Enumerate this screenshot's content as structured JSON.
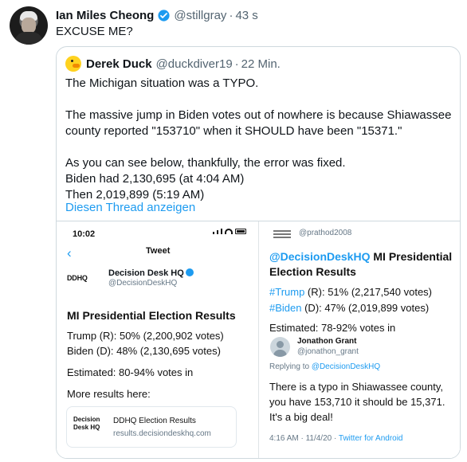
{
  "tweet": {
    "author_name": "Ian Miles Cheong",
    "author_handle": "@stillgray",
    "separator": "·",
    "time": "43 s",
    "text": "EXCUSE ME?"
  },
  "quote": {
    "author_name": "Derek Duck",
    "author_handle": "@duckdiver19",
    "separator": "·",
    "time": "22 Min.",
    "body": [
      "The Michigan situation was a TYPO.",
      "The massive jump in Biden votes out of nowhere is because Shiawassee county reported \"153710\" when it SHOULD have been \"15371.\"",
      "As you can see below, thankfully, the error was fixed.",
      "Biden had 2,130,695 (at 4:04 AM)",
      "Then 2,019,899 (5:19 AM)"
    ],
    "thread_link": "Diesen Thread anzeigen"
  },
  "media": {
    "left": {
      "status_time": "10:02",
      "back_icon": "chevron-left-icon",
      "heading": "Tweet",
      "account_name": "Decision Desk HQ",
      "account_handle": "@DecisionDeskHQ",
      "account_logo": "DDHQ",
      "title": "MI Presidential Election Results",
      "line1": "Trump (R): 50% (2,200,902 votes)",
      "line2": "Biden (D): 48% (2,130,695 votes)",
      "line3": "Estimated: 80-94% votes in",
      "line4": "More results here:",
      "card_logo": "Decision\nDesk HQ",
      "card_title": "DDHQ Election Results",
      "card_url": "results.decisiondeskhq.com"
    },
    "right": {
      "handle": "@prathod2008",
      "title_mention": "@DecisionDeskHQ",
      "title_rest": " MI Presidential Election Results",
      "trump_tag": "#Trump",
      "trump_rest": " (R): 51% (2,217,540 votes)",
      "biden_tag": "#Biden",
      "biden_rest": " (D): 47% (2,019,899 votes)",
      "estimate": "Estimated: 78-92% votes in",
      "reply_name": "Jonathon Grant",
      "reply_handle": "@jonathon_grant",
      "replying_prefix": "Replying to ",
      "replying_to": "@DecisionDeskHQ",
      "reply_text": [
        "There is a typo in Shiawassee county,",
        "you have 153,710 it should be 15,371.",
        "It's a big deal!"
      ],
      "meta_prefix": "4:16 AM · 11/4/20 · ",
      "meta_source": "Twitter for Android"
    }
  },
  "colors": {
    "link": "#1d9bf0",
    "muted": "#536471",
    "border": "#cfd9de"
  }
}
